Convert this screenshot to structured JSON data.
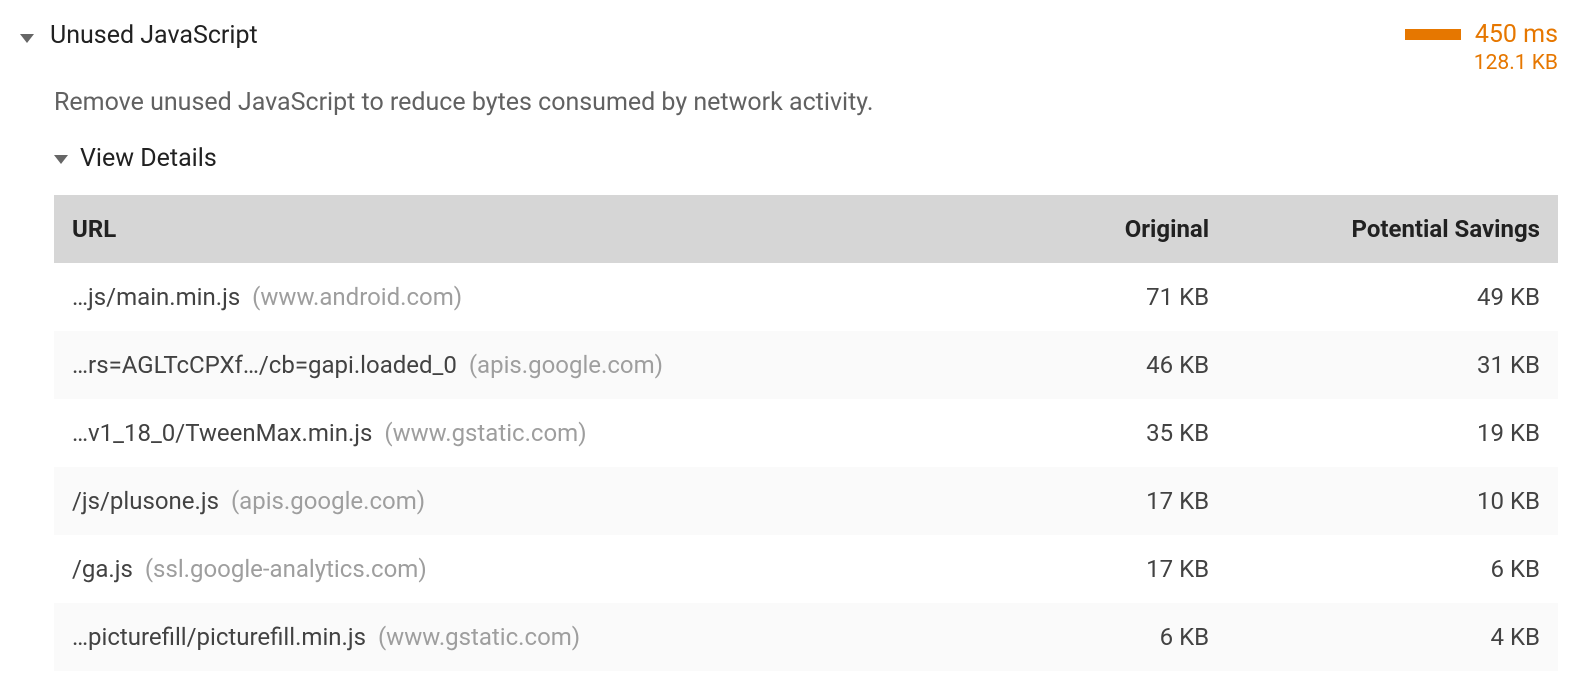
{
  "audit": {
    "title": "Unused JavaScript",
    "description": "Remove unused JavaScript to reduce bytes consumed by network activity.",
    "time_label": "450 ms",
    "size_label": "128.1 KB",
    "details_label": "View Details"
  },
  "table": {
    "headers": {
      "url": "URL",
      "original": "Original",
      "savings": "Potential Savings"
    },
    "rows": [
      {
        "path": "…js/main.min.js",
        "host": "(www.android.com)",
        "original": "71 KB",
        "savings": "49 KB"
      },
      {
        "path": "…rs=AGLTcCPXf…/cb=gapi.loaded_0",
        "host": "(apis.google.com)",
        "original": "46 KB",
        "savings": "31 KB"
      },
      {
        "path": "…v1_18_0/TweenMax.min.js",
        "host": "(www.gstatic.com)",
        "original": "35 KB",
        "savings": "19 KB"
      },
      {
        "path": "/js/plusone.js",
        "host": "(apis.google.com)",
        "original": "17 KB",
        "savings": "10 KB"
      },
      {
        "path": "/ga.js",
        "host": "(ssl.google-analytics.com)",
        "original": "17 KB",
        "savings": "6 KB"
      },
      {
        "path": "…picturefill/picturefill.min.js",
        "host": "(www.gstatic.com)",
        "original": "6 KB",
        "savings": "4 KB"
      }
    ]
  }
}
